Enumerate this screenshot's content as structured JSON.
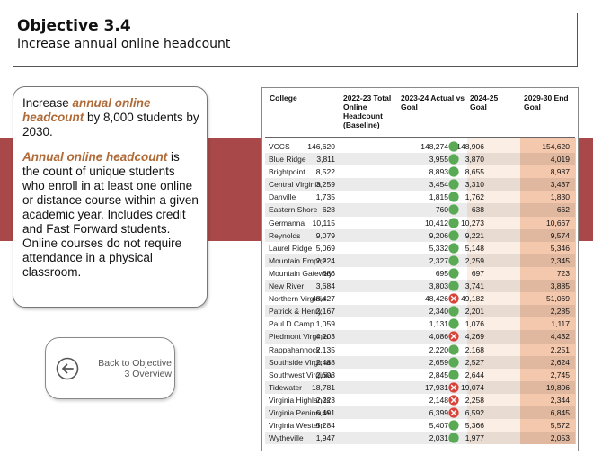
{
  "header": {
    "title": "Objective 3.4",
    "subtitle": "Increase annual online headcount"
  },
  "description": {
    "p1_pre": "Increase ",
    "p1_highlight": "annual online headcount",
    "p1_post": " by 8,000 students by 2030.",
    "p2_highlight": "Annual online headcount",
    "p2_post": " is the count of unique students who enroll in at least one online or distance course within a given academic year.  Includes credit and Fast Forward students.  Online courses do not require attendance in a physical classroom."
  },
  "back_button": {
    "label_line1": "Back to Objective",
    "label_line2": "3 Overview",
    "icon": "back-arrow-circle-icon"
  },
  "table": {
    "headers": {
      "college": "College",
      "baseline": "2022-23 Total Online Headcount (Baseline)",
      "actual": "2023-24 Actual vs Goal",
      "goal": "2024-25 Goal",
      "end_goal": "2029-30 End Goal"
    },
    "colors": {
      "met": "#5aaa55",
      "missed": "#d9443a",
      "goal_col": "#fbeee4",
      "end_col": "#f4c8ad"
    },
    "rows": [
      {
        "college": "VCCS",
        "baseline": "146,620",
        "actual": "148,274",
        "status": "met",
        "goal": "148,906",
        "end": "154,620"
      },
      {
        "college": "Blue Ridge",
        "baseline": "3,811",
        "actual": "3,955",
        "status": "met",
        "goal": "3,870",
        "end": "4,019"
      },
      {
        "college": "Brightpoint",
        "baseline": "8,522",
        "actual": "8,893",
        "status": "met",
        "goal": "8,655",
        "end": "8,987"
      },
      {
        "college": "Central Virginia",
        "baseline": "3,259",
        "actual": "3,454",
        "status": "met",
        "goal": "3,310",
        "end": "3,437"
      },
      {
        "college": "Danville",
        "baseline": "1,735",
        "actual": "1,815",
        "status": "met",
        "goal": "1,762",
        "end": "1,830"
      },
      {
        "college": "Eastern Shore",
        "baseline": "628",
        "actual": "760",
        "status": "met",
        "goal": "638",
        "end": "662"
      },
      {
        "college": "Germanna",
        "baseline": "10,115",
        "actual": "10,412",
        "status": "met",
        "goal": "10,273",
        "end": "10,667"
      },
      {
        "college": "Reynolds",
        "baseline": "9,079",
        "actual": "9,206",
        "status": "met",
        "goal": "9,221",
        "end": "9,574"
      },
      {
        "college": "Laurel Ridge",
        "baseline": "5,069",
        "actual": "5,332",
        "status": "met",
        "goal": "5,148",
        "end": "5,346"
      },
      {
        "college": "Mountain Empire",
        "baseline": "2,224",
        "actual": "2,327",
        "status": "met",
        "goal": "2,259",
        "end": "2,345"
      },
      {
        "college": "Mountain Gateway",
        "baseline": "686",
        "actual": "695",
        "status": "met",
        "goal": "697",
        "end": "723"
      },
      {
        "college": "New River",
        "baseline": "3,684",
        "actual": "3,803",
        "status": "met",
        "goal": "3,741",
        "end": "3,885"
      },
      {
        "college": "Northern Virginia",
        "baseline": "48,427",
        "actual": "48,426",
        "status": "missed",
        "goal": "49,182",
        "end": "51,069"
      },
      {
        "college": "Patrick & Henry",
        "baseline": "2,167",
        "actual": "2,340",
        "status": "met",
        "goal": "2,201",
        "end": "2,285"
      },
      {
        "college": "Paul D Camp",
        "baseline": "1,059",
        "actual": "1,131",
        "status": "met",
        "goal": "1,076",
        "end": "1,117"
      },
      {
        "college": "Piedmont Virginia",
        "baseline": "4,203",
        "actual": "4,086",
        "status": "missed",
        "goal": "4,269",
        "end": "4,432"
      },
      {
        "college": "Rappahannock",
        "baseline": "2,135",
        "actual": "2,220",
        "status": "met",
        "goal": "2,168",
        "end": "2,251"
      },
      {
        "college": "Southside Virginia",
        "baseline": "2,488",
        "actual": "2,659",
        "status": "met",
        "goal": "2,527",
        "end": "2,624"
      },
      {
        "college": "Southwest Virginia",
        "baseline": "2,603",
        "actual": "2,845",
        "status": "met",
        "goal": "2,644",
        "end": "2,745"
      },
      {
        "college": "Tidewater",
        "baseline": "18,781",
        "actual": "17,931",
        "status": "missed",
        "goal": "19,074",
        "end": "19,806"
      },
      {
        "college": "Virginia Highlands",
        "baseline": "2,223",
        "actual": "2,148",
        "status": "missed",
        "goal": "2,258",
        "end": "2,344"
      },
      {
        "college": "Virginia Peninsula",
        "baseline": "6,491",
        "actual": "6,399",
        "status": "missed",
        "goal": "6,592",
        "end": "6,845"
      },
      {
        "college": "Virginia Western",
        "baseline": "5,284",
        "actual": "5,407",
        "status": "met",
        "goal": "5,366",
        "end": "5,572"
      },
      {
        "college": "Wytheville",
        "baseline": "1,947",
        "actual": "2,031",
        "status": "met",
        "goal": "1,977",
        "end": "2,053"
      }
    ]
  }
}
